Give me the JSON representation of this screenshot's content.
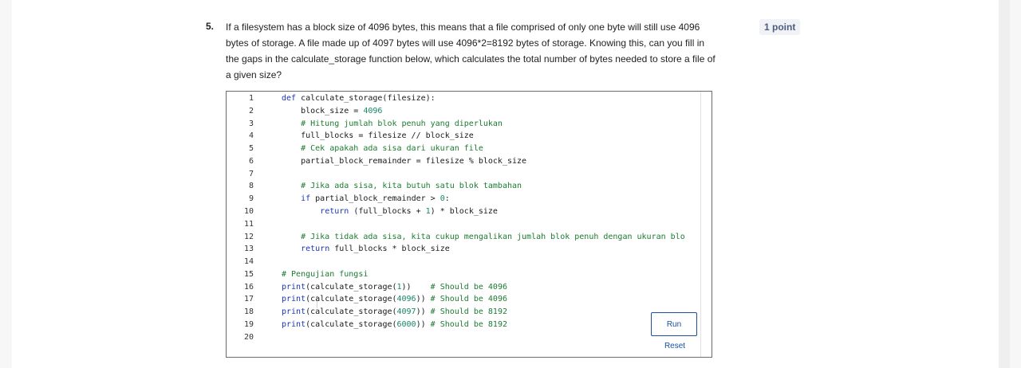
{
  "question": {
    "number": "5.",
    "text": "If a filesystem has a block size of 4096 bytes, this means that a file comprised of only one byte will still use 4096 bytes of storage. A file made up of 4097 bytes will use 4096*2=8192 bytes of storage. Knowing this, can you fill in the gaps in the calculate_storage function below, which calculates the total number of bytes needed to store a file of a given size?",
    "points": "1 point"
  },
  "editor": {
    "line_numbers": [
      "1",
      "2",
      "3",
      "4",
      "5",
      "6",
      "7",
      "8",
      "9",
      "10",
      "11",
      "12",
      "13",
      "14",
      "15",
      "16",
      "17",
      "18",
      "19",
      "20"
    ],
    "lines": [
      [
        {
          "t": "def",
          "c": "kw"
        },
        {
          "t": " calculate_storage(filesize):",
          "c": ""
        }
      ],
      [
        {
          "t": "    block_size = ",
          "c": ""
        },
        {
          "t": "4096",
          "c": "num"
        }
      ],
      [
        {
          "t": "    # Hitung jumlah blok penuh yang diperlukan",
          "c": "cm"
        }
      ],
      [
        {
          "t": "    full_blocks = filesize // block_size",
          "c": ""
        }
      ],
      [
        {
          "t": "    # Cek apakah ada sisa dari ukuran file",
          "c": "cm"
        }
      ],
      [
        {
          "t": "    partial_block_remainder = filesize % block_size",
          "c": ""
        }
      ],
      [],
      [
        {
          "t": "    # Jika ada sisa, kita butuh satu blok tambahan",
          "c": "cm"
        }
      ],
      [
        {
          "t": "    ",
          "c": ""
        },
        {
          "t": "if",
          "c": "kw"
        },
        {
          "t": " partial_block_remainder > ",
          "c": ""
        },
        {
          "t": "0",
          "c": "num"
        },
        {
          "t": ":",
          "c": ""
        }
      ],
      [
        {
          "t": "        ",
          "c": ""
        },
        {
          "t": "return",
          "c": "kw"
        },
        {
          "t": " (full_blocks + ",
          "c": ""
        },
        {
          "t": "1",
          "c": "num"
        },
        {
          "t": ") * block_size",
          "c": ""
        }
      ],
      [],
      [
        {
          "t": "    # Jika tidak ada sisa, kita cukup mengalikan jumlah blok penuh dengan ukuran blo",
          "c": "cm"
        }
      ],
      [
        {
          "t": "    ",
          "c": ""
        },
        {
          "t": "return",
          "c": "kw"
        },
        {
          "t": " full_blocks * block_size",
          "c": ""
        }
      ],
      [],
      [
        {
          "t": "# Pengujian fungsi",
          "c": "cm"
        }
      ],
      [
        {
          "t": "print",
          "c": "kw"
        },
        {
          "t": "(calculate_storage(",
          "c": ""
        },
        {
          "t": "1",
          "c": "num"
        },
        {
          "t": "))    ",
          "c": ""
        },
        {
          "t": "# Should be 4096",
          "c": "cm"
        }
      ],
      [
        {
          "t": "print",
          "c": "kw"
        },
        {
          "t": "(calculate_storage(",
          "c": ""
        },
        {
          "t": "4096",
          "c": "num"
        },
        {
          "t": ")) ",
          "c": ""
        },
        {
          "t": "# Should be 4096",
          "c": "cm"
        }
      ],
      [
        {
          "t": "print",
          "c": "kw"
        },
        {
          "t": "(calculate_storage(",
          "c": ""
        },
        {
          "t": "4097",
          "c": "num"
        },
        {
          "t": ")) ",
          "c": ""
        },
        {
          "t": "# Should be 8192",
          "c": "cm"
        }
      ],
      [
        {
          "t": "print",
          "c": "kw"
        },
        {
          "t": "(calculate_storage(",
          "c": ""
        },
        {
          "t": "6000",
          "c": "num"
        },
        {
          "t": ")) ",
          "c": ""
        },
        {
          "t": "# Should be 8192",
          "c": "cm"
        }
      ],
      []
    ]
  },
  "buttons": {
    "run": "Run",
    "reset": "Reset"
  },
  "colors": {
    "keyword": "#1a35b5",
    "comment": "#1d7a32",
    "number": "#16866a",
    "link": "#1a4fa0"
  }
}
